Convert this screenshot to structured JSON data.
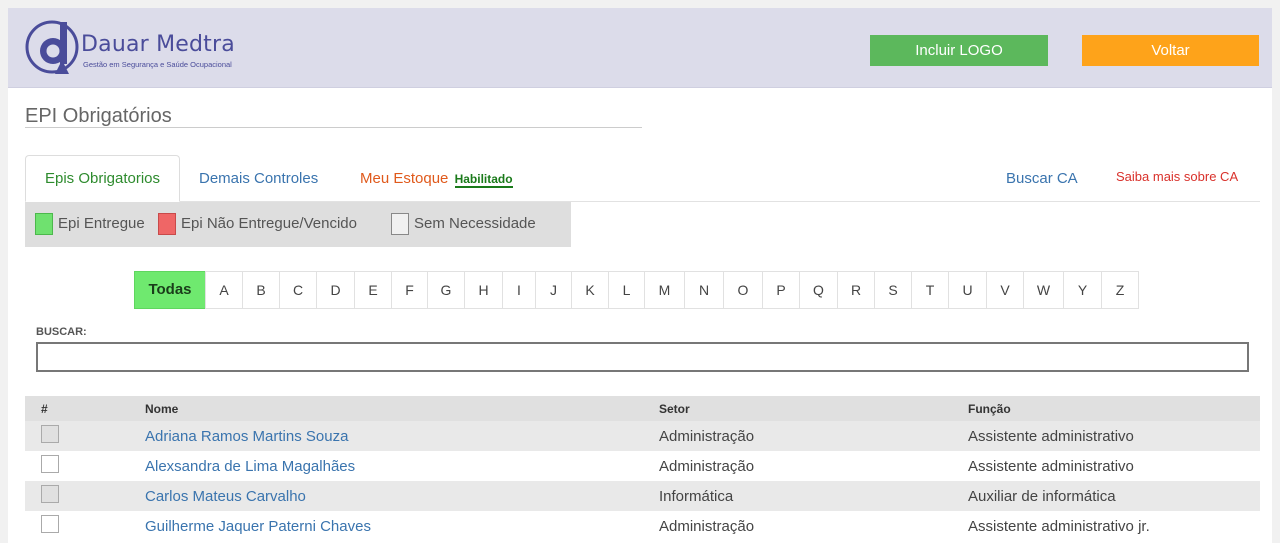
{
  "brand": {
    "name": "Dauar Medtra",
    "tagline": "Gestão em Segurança e Saúde Ocupacional",
    "brand_color": "#4a4c9a"
  },
  "header": {
    "include_logo_label": "Incluir LOGO",
    "back_label": "Voltar",
    "include_logo_color": "#5cb85c",
    "back_color": "#fea31a"
  },
  "page_title": "EPI Obrigatórios",
  "tabs": {
    "epis": "Epis Obrigatorios",
    "demais": "Demais Controles",
    "estoque": "Meu Estoque",
    "estoque_status": "Habilitado",
    "buscar_ca": "Buscar CA",
    "saiba_ca": "Saiba mais sobre CA"
  },
  "legend": {
    "entregue": "Epi Entregue",
    "nao_entregue": "Epi Não Entregue/Vencido",
    "sem_necessidade": "Sem Necessidade",
    "entregue_color": "#6fe16f",
    "nao_entregue_color": "#ef6666"
  },
  "filter": {
    "active": "Todas",
    "letters": [
      "Todas",
      "A",
      "B",
      "C",
      "D",
      "E",
      "F",
      "G",
      "H",
      "I",
      "J",
      "K",
      "L",
      "M",
      "N",
      "O",
      "P",
      "Q",
      "R",
      "S",
      "T",
      "U",
      "V",
      "W",
      "Y",
      "Z"
    ]
  },
  "search": {
    "label": "BUSCAR:",
    "value": ""
  },
  "table": {
    "columns": {
      "hash": "#",
      "nome": "Nome",
      "setor": "Setor",
      "funcao": "Função"
    },
    "rows": [
      {
        "nome": "Adriana Ramos Martins Souza",
        "setor": "Administração",
        "funcao": "Assistente administrativo"
      },
      {
        "nome": "Alexsandra de Lima Magalhães",
        "setor": "Administração",
        "funcao": "Assistente administrativo"
      },
      {
        "nome": "Carlos Mateus Carvalho",
        "setor": "Informática",
        "funcao": "Auxiliar de informática"
      },
      {
        "nome": "Guilherme Jaquer Paterni Chaves",
        "setor": "Administração",
        "funcao": "Assistente administrativo jr."
      }
    ]
  }
}
